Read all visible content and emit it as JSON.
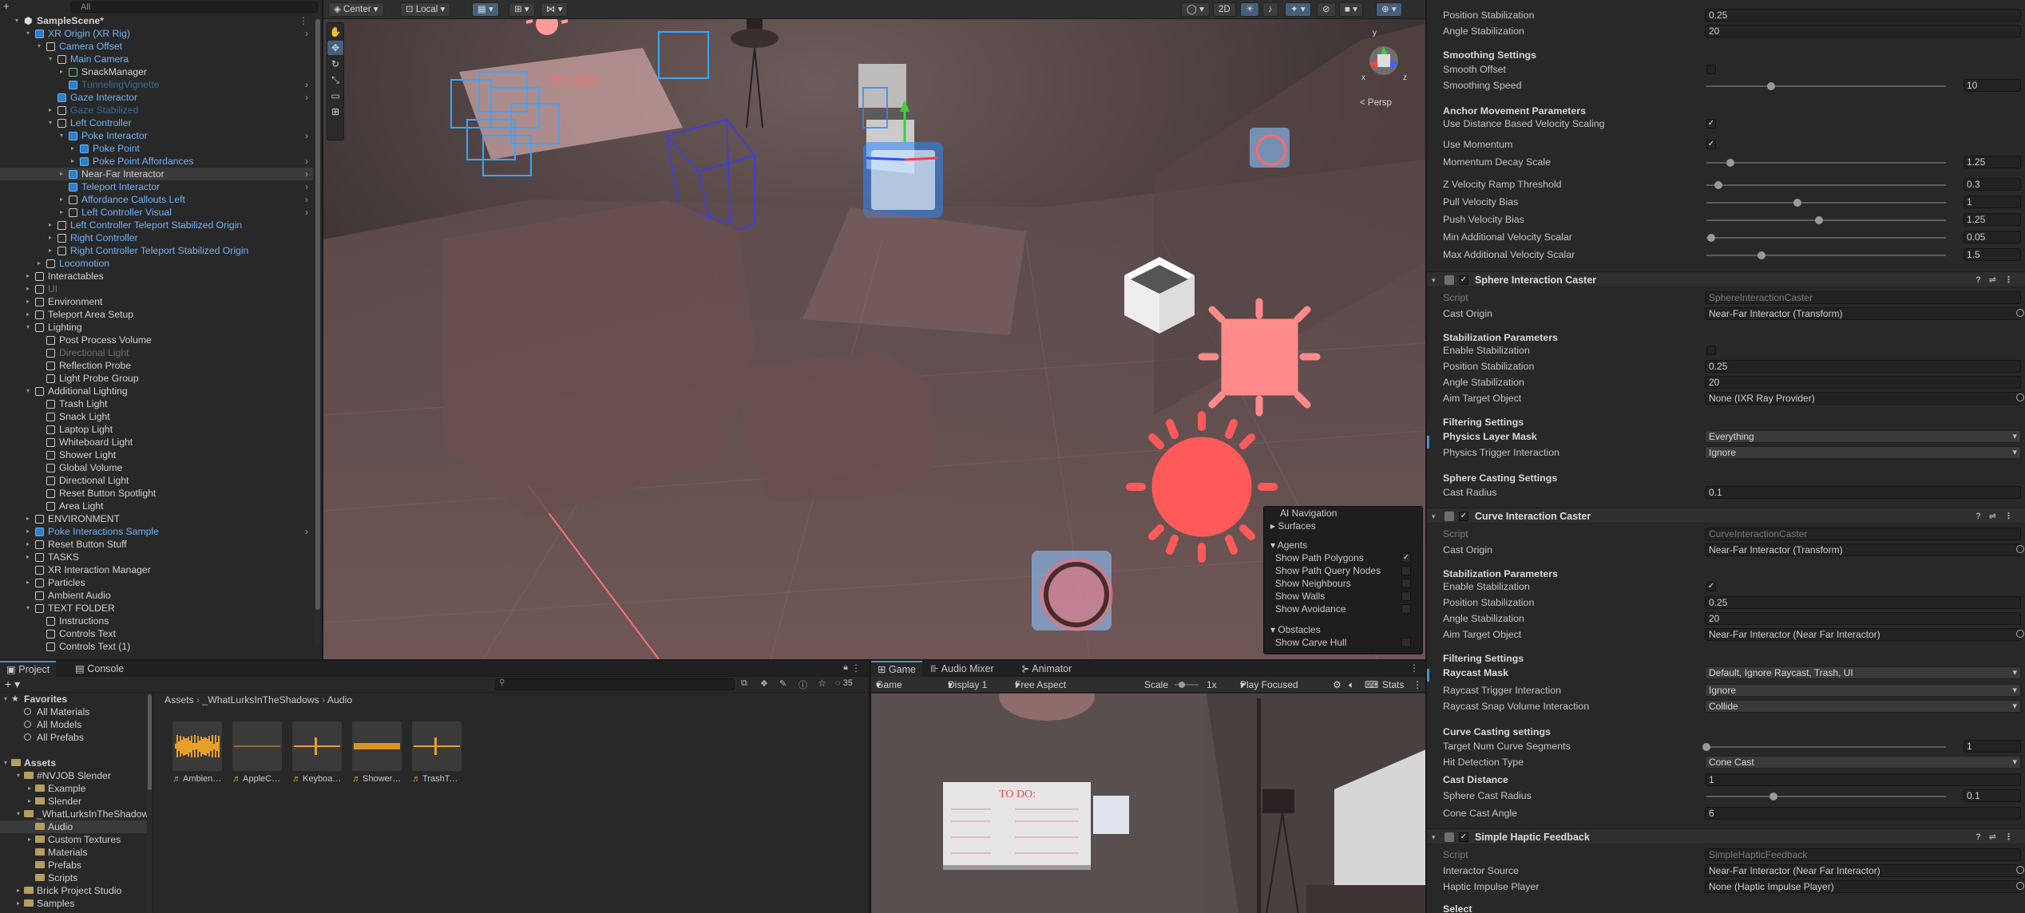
{
  "hierarchy": {
    "search_placeholder": "All",
    "rows": [
      {
        "label": "SampleScene*",
        "indent": 0,
        "arrow": "▾",
        "icon": "unity",
        "style": "scene"
      },
      {
        "label": "XR Origin (XR Rig)",
        "indent": 1,
        "arrow": "▾",
        "icon": "blue",
        "style": "prefab",
        "more": true
      },
      {
        "label": "Camera Offset",
        "indent": 2,
        "arrow": "▾",
        "icon": "plain",
        "style": "prefab"
      },
      {
        "label": "Main Camera",
        "indent": 3,
        "arrow": "▾",
        "icon": "plain",
        "style": "prefab"
      },
      {
        "label": "SnackManager",
        "indent": 4,
        "arrow": "▸",
        "icon": "green",
        "style": "normal"
      },
      {
        "label": "TunnelingVignette",
        "indent": 4,
        "arrow": "",
        "icon": "blue",
        "style": "prefabdim",
        "more": true
      },
      {
        "label": "Gaze Interactor",
        "indent": 3,
        "arrow": "",
        "icon": "blue",
        "style": "prefab",
        "more": true
      },
      {
        "label": "Gaze Stabilized",
        "indent": 3,
        "arrow": "▸",
        "icon": "plain",
        "style": "prefabdim"
      },
      {
        "label": "Left Controller",
        "indent": 3,
        "arrow": "▾",
        "icon": "plain",
        "style": "prefab"
      },
      {
        "label": "Poke Interactor",
        "indent": 4,
        "arrow": "▾",
        "icon": "blue",
        "style": "prefab",
        "more": true
      },
      {
        "label": "Poke Point",
        "indent": 5,
        "arrow": "▸",
        "icon": "blue",
        "style": "prefab"
      },
      {
        "label": "Poke Point Affordances",
        "indent": 5,
        "arrow": "▸",
        "icon": "blue",
        "style": "prefab",
        "more": true
      },
      {
        "label": "Near-Far Interactor",
        "indent": 4,
        "arrow": "▸",
        "icon": "blue",
        "style": "normal",
        "selected": true,
        "more": true
      },
      {
        "label": "Teleport Interactor",
        "indent": 4,
        "arrow": "",
        "icon": "blue",
        "style": "prefab",
        "more": true
      },
      {
        "label": "Affordance Callouts Left",
        "indent": 4,
        "arrow": "▸",
        "icon": "plain",
        "style": "prefab",
        "more": true
      },
      {
        "label": "Left Controller Visual",
        "indent": 4,
        "arrow": "▸",
        "icon": "plain",
        "style": "prefab",
        "more": true
      },
      {
        "label": "Left Controller Teleport Stabilized Origin",
        "indent": 3,
        "arrow": "▸",
        "icon": "plain",
        "style": "prefab"
      },
      {
        "label": "Right Controller",
        "indent": 3,
        "arrow": "▸",
        "icon": "plain",
        "style": "prefab"
      },
      {
        "label": "Right Controller Teleport Stabilized Origin",
        "indent": 3,
        "arrow": "▸",
        "icon": "plain",
        "style": "prefab"
      },
      {
        "label": "Locomotion",
        "indent": 2,
        "arrow": "▸",
        "icon": "plain",
        "style": "prefab"
      },
      {
        "label": "Interactables",
        "indent": 1,
        "arrow": "▸",
        "icon": "plain",
        "style": "normal"
      },
      {
        "label": "UI",
        "indent": 1,
        "arrow": "▸",
        "icon": "plain",
        "style": "dim"
      },
      {
        "label": "Environment",
        "indent": 1,
        "arrow": "▸",
        "icon": "plain",
        "style": "normal"
      },
      {
        "label": "Teleport Area Setup",
        "indent": 1,
        "arrow": "▸",
        "icon": "plain",
        "style": "normal"
      },
      {
        "label": "Lighting",
        "indent": 1,
        "arrow": "▾",
        "icon": "plain",
        "style": "normal"
      },
      {
        "label": "Post Process Volume",
        "indent": 2,
        "arrow": "",
        "icon": "plain",
        "style": "normal"
      },
      {
        "label": "Directional Light",
        "indent": 2,
        "arrow": "",
        "icon": "plain",
        "style": "dim"
      },
      {
        "label": "Reflection Probe",
        "indent": 2,
        "arrow": "",
        "icon": "plain",
        "style": "normal"
      },
      {
        "label": "Light Probe Group",
        "indent": 2,
        "arrow": "",
        "icon": "plain",
        "style": "normal"
      },
      {
        "label": "Additional Lighting",
        "indent": 1,
        "arrow": "▾",
        "icon": "plain",
        "style": "normal"
      },
      {
        "label": "Trash Light",
        "indent": 2,
        "arrow": "",
        "icon": "plain",
        "style": "normal"
      },
      {
        "label": "Snack Light",
        "indent": 2,
        "arrow": "",
        "icon": "plain",
        "style": "normal"
      },
      {
        "label": "Laptop Light",
        "indent": 2,
        "arrow": "",
        "icon": "plain",
        "style": "normal"
      },
      {
        "label": "Whiteboard Light",
        "indent": 2,
        "arrow": "",
        "icon": "plain",
        "style": "normal"
      },
      {
        "label": "Shower Light",
        "indent": 2,
        "arrow": "",
        "icon": "plain",
        "style": "normal"
      },
      {
        "label": "Global Volume",
        "indent": 2,
        "arrow": "",
        "icon": "plain",
        "style": "normal"
      },
      {
        "label": "Directional Light",
        "indent": 2,
        "arrow": "",
        "icon": "plain",
        "style": "normal"
      },
      {
        "label": "Reset Button Spotlight",
        "indent": 2,
        "arrow": "",
        "icon": "plain",
        "style": "normal"
      },
      {
        "label": "Area Light",
        "indent": 2,
        "arrow": "",
        "icon": "plain",
        "style": "normal"
      },
      {
        "label": "ENVIRONMENT",
        "indent": 1,
        "arrow": "▸",
        "icon": "plain",
        "style": "normal"
      },
      {
        "label": "Poke Interactions Sample",
        "indent": 1,
        "arrow": "▸",
        "icon": "blue",
        "style": "prefab",
        "more": true
      },
      {
        "label": "Reset Button Stuff",
        "indent": 1,
        "arrow": "▸",
        "icon": "plain",
        "style": "normal"
      },
      {
        "label": "TASKS",
        "indent": 1,
        "arrow": "▸",
        "icon": "plain",
        "style": "normal"
      },
      {
        "label": "XR Interaction Manager",
        "indent": 1,
        "arrow": "",
        "icon": "plain",
        "style": "normal"
      },
      {
        "label": "Particles",
        "indent": 1,
        "arrow": "▸",
        "icon": "plain",
        "style": "normal"
      },
      {
        "label": "Ambient Audio",
        "indent": 1,
        "arrow": "",
        "icon": "plain",
        "style": "normal"
      },
      {
        "label": "TEXT FOLDER",
        "indent": 1,
        "arrow": "▾",
        "icon": "plain",
        "style": "normal"
      },
      {
        "label": "Instructions",
        "indent": 2,
        "arrow": "",
        "icon": "plain",
        "style": "normal"
      },
      {
        "label": "Controls Text",
        "indent": 2,
        "arrow": "",
        "icon": "plain",
        "style": "normal"
      },
      {
        "label": "Controls Text (1)",
        "indent": 2,
        "arrow": "",
        "icon": "plain",
        "style": "normal"
      }
    ]
  },
  "scene_toolbar": {
    "pivot": "Center",
    "space": "Local",
    "mode_2d": "2D",
    "persp_label": "< Persp"
  },
  "scene_text": {
    "todo_board": "TO DO:",
    "gizmo_axes": {
      "x": "x",
      "y": "y",
      "z": "z"
    }
  },
  "ai_nav": {
    "title": "AI Navigation",
    "surfaces": "Surfaces",
    "agents": "Agents",
    "agent_opts": [
      {
        "label": "Show Path Polygons",
        "checked": true
      },
      {
        "label": "Show Path Query Nodes",
        "checked": false
      },
      {
        "label": "Show Neighbours",
        "checked": false
      },
      {
        "label": "Show Walls",
        "checked": false
      },
      {
        "label": "Show Avoidance",
        "checked": false
      }
    ],
    "obstacles": "Obstacles",
    "obstacle_opts": [
      {
        "label": "Show Carve Hull",
        "checked": false
      }
    ]
  },
  "inspector": {
    "top": [
      {
        "type": "field",
        "label": "Position Stabilization",
        "value": "0.25"
      },
      {
        "type": "field",
        "label": "Angle Stabilization",
        "value": "20"
      },
      {
        "type": "header",
        "label": "Smoothing Settings"
      },
      {
        "type": "check",
        "label": "Smooth Offset",
        "checked": false
      },
      {
        "type": "slider",
        "label": "Smoothing Speed",
        "value": "10",
        "pos": 0.27
      },
      {
        "type": "header",
        "label": "Anchor Movement Parameters"
      },
      {
        "type": "check",
        "label": "Use Distance Based Velocity Scaling",
        "checked": true
      },
      {
        "type": "check",
        "label": "Use Momentum",
        "checked": true
      },
      {
        "type": "slider",
        "label": "Momentum Decay Scale",
        "value": "1.25",
        "pos": 0.1
      },
      {
        "type": "slider",
        "label": "Z Velocity Ramp Threshold",
        "value": "0.3",
        "pos": 0.05
      },
      {
        "type": "slider",
        "label": "Pull Velocity Bias",
        "value": "1",
        "pos": 0.38
      },
      {
        "type": "slider",
        "label": "Push Velocity Bias",
        "value": "1.25",
        "pos": 0.47
      },
      {
        "type": "slider",
        "label": "Min Additional Velocity Scalar",
        "value": "0.05",
        "pos": 0.02
      },
      {
        "type": "slider",
        "label": "Max Additional Velocity Scalar",
        "value": "1.5",
        "pos": 0.23
      }
    ],
    "sphere": {
      "title": "Sphere Interaction Caster",
      "script": "SphereInteractionCaster",
      "cast_origin": "Near-Far Interactor (Transform)",
      "stab_header": "Stabilization Parameters",
      "enable_stab": false,
      "pos_stab": "0.25",
      "ang_stab": "20",
      "aim_target": "None (IXR Ray Provider)",
      "filter_header": "Filtering Settings",
      "physics_layer": "Everything",
      "physics_trigger": "Ignore",
      "casting_header": "Sphere Casting Settings",
      "cast_radius": "0.1"
    },
    "curve": {
      "title": "Curve Interaction Caster",
      "script": "CurveInteractionCaster",
      "cast_origin": "Near-Far Interactor (Transform)",
      "stab_header": "Stabilization Parameters",
      "enable_stab": true,
      "pos_stab": "0.25",
      "ang_stab": "20",
      "aim_target": "Near-Far Interactor (Near Far Interactor)",
      "filter_header": "Filtering Settings",
      "raycast_mask": "Default, Ignore Raycast, Trash, UI",
      "raycast_trigger": "Ignore",
      "raycast_snap": "Collide",
      "casting_header": "Curve Casting settings",
      "segments": "1",
      "segments_pos": 0.0,
      "hit_detection": "Cone Cast",
      "cast_distance": "1",
      "sphere_radius": "0.1",
      "sphere_radius_pos": 0.28,
      "cone_angle": "6"
    },
    "haptic": {
      "title": "Simple Haptic Feedback",
      "script": "SimpleHapticFeedback",
      "source": "Near-Far Interactor (Near Far Interactor)",
      "player": "None (Haptic Impulse Player)",
      "select": "Select"
    },
    "labels": {
      "script": "Script",
      "cast_origin": "Cast Origin",
      "enable_stab": "Enable Stabilization",
      "pos_stab": "Position Stabilization",
      "ang_stab": "Angle Stabilization",
      "aim_target": "Aim Target Object",
      "physics_layer": "Physics Layer Mask",
      "physics_trigger": "Physics Trigger Interaction",
      "cast_radius": "Cast Radius",
      "raycast_mask": "Raycast Mask",
      "raycast_trigger": "Raycast Trigger Interaction",
      "raycast_snap": "Raycast Snap Volume Interaction",
      "segments": "Target Num Curve Segments",
      "hit_detection": "Hit Detection Type",
      "cast_distance": "Cast Distance",
      "sphere_radius": "Sphere Cast Radius",
      "cone_angle": "Cone Cast Angle",
      "source": "Interactor Source",
      "player": "Haptic Impulse Player"
    }
  },
  "project": {
    "tabs": [
      "Project",
      "Console"
    ],
    "favorites": "Favorites",
    "fav_items": [
      "All Materials",
      "All Models",
      "All Prefabs"
    ],
    "assets_label": "Assets",
    "tree": [
      {
        "label": "#NVJOB Slender",
        "indent": 1,
        "arrow": "▾"
      },
      {
        "label": "Example",
        "indent": 2,
        "arrow": "▸"
      },
      {
        "label": "Slender",
        "indent": 2,
        "arrow": "▸"
      },
      {
        "label": "_WhatLurksInTheShadows",
        "indent": 1,
        "arrow": "▾"
      },
      {
        "label": "Audio",
        "indent": 2,
        "arrow": "",
        "selected": true
      },
      {
        "label": "Custom Textures",
        "indent": 2,
        "arrow": "▸"
      },
      {
        "label": "Materials",
        "indent": 2,
        "arrow": ""
      },
      {
        "label": "Prefabs",
        "indent": 2,
        "arrow": ""
      },
      {
        "label": "Scripts",
        "indent": 2,
        "arrow": ""
      },
      {
        "label": "Brick Project Studio",
        "indent": 1,
        "arrow": "▸"
      },
      {
        "label": "Samples",
        "indent": 1,
        "arrow": "▸"
      }
    ],
    "breadcrumb": [
      "Assets",
      "_WhatLurksInTheShadows",
      "Audio"
    ],
    "asset_count": "35",
    "assets": [
      {
        "name": "Ambient A...",
        "wave": "dense"
      },
      {
        "name": "AppleCrun...",
        "wave": "flat"
      },
      {
        "name": "KeyboardCl...",
        "wave": "spike"
      },
      {
        "name": "ShowerRu...",
        "wave": "mid"
      },
      {
        "name": "TrashToss...",
        "wave": "spike"
      }
    ]
  },
  "game": {
    "tabs": [
      "Game",
      "Audio Mixer",
      "Animator"
    ],
    "mode": "Game",
    "display": "Display 1",
    "aspect": "Free Aspect",
    "scale_label": "Scale",
    "scale_value": "1x",
    "play_focused": "Play Focused",
    "stats": "Stats",
    "todo_board": "TO DO:"
  }
}
